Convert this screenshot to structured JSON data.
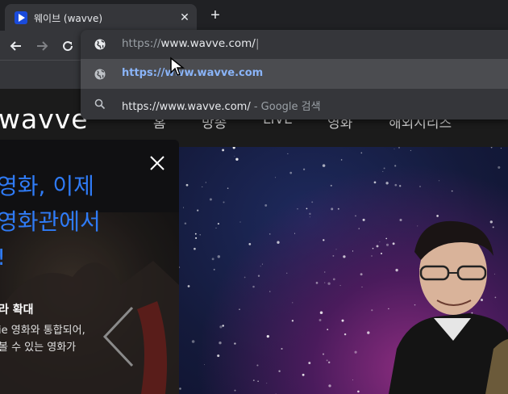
{
  "tab": {
    "title": "웨이브 (wavve)"
  },
  "omnibox": {
    "value_proto": "https://",
    "value_host": "www.wavve.com/",
    "suggestions": [
      {
        "text": "https://www.wavve.com",
        "icon": "globe-icon"
      },
      {
        "text": "https://www.wavve.com/",
        "suffix": "- Google 검색",
        "icon": "search-icon"
      }
    ]
  },
  "site": {
    "logo": "wavve",
    "menu": [
      "홈",
      "방송",
      "LIVE",
      "영화",
      "해외시리즈"
    ]
  },
  "popup": {
    "headline": [
      "영화, 이제",
      "영화관에서",
      "!"
    ],
    "subtitle": "라 확대",
    "description": [
      "ie 영화와 통합되어,",
      "볼 수 있는 영화가"
    ]
  },
  "colors": {
    "accent": "#2f7bf6",
    "link": "#8ab4f8"
  }
}
